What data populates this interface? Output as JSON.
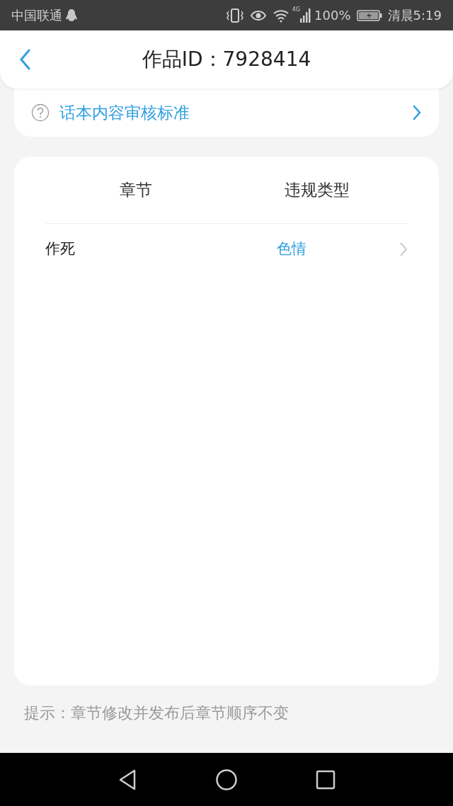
{
  "status_bar": {
    "carrier": "中国联通",
    "network": "4G",
    "battery": "100%",
    "time": "清晨5:19"
  },
  "header": {
    "title": "作品ID：7928414"
  },
  "standards_link": {
    "label": "话本内容审核标准"
  },
  "table": {
    "columns": [
      "章节",
      "违规类型"
    ],
    "rows": [
      {
        "chapter": "作死",
        "violation": "色情"
      }
    ]
  },
  "tip": "提示：章节修改并发布后章节顺序不变"
}
